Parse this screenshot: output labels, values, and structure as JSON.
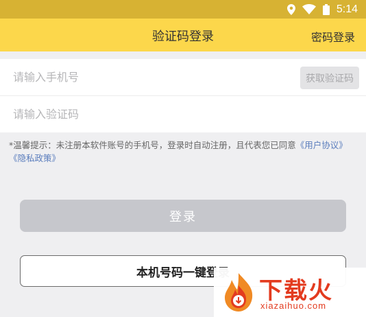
{
  "status_bar": {
    "time": "5:14",
    "icons": [
      "location-icon",
      "wifi-icon",
      "battery-icon"
    ]
  },
  "header": {
    "title": "验证码登录",
    "right_link": "密码登录"
  },
  "form": {
    "phone_placeholder": "请输入手机号",
    "code_button": "获取验证码",
    "code_placeholder": "请输入验证码"
  },
  "notice": {
    "text": "*温馨提示：未注册本软件账号的手机号，登录时自动注册，且代表您已同意",
    "user_agreement": "《用户协议》",
    "privacy_policy": "《隐私政策》"
  },
  "login_button": "登录",
  "onekey_button": "本机号码一键登录",
  "watermark": {
    "title": "下载火",
    "url": "xiazaihuo.com"
  },
  "colors": {
    "header": "#fcd74b",
    "status_bar": "#d7b233",
    "link": "#5a7dbd",
    "brand_red": "#e33b1f"
  }
}
